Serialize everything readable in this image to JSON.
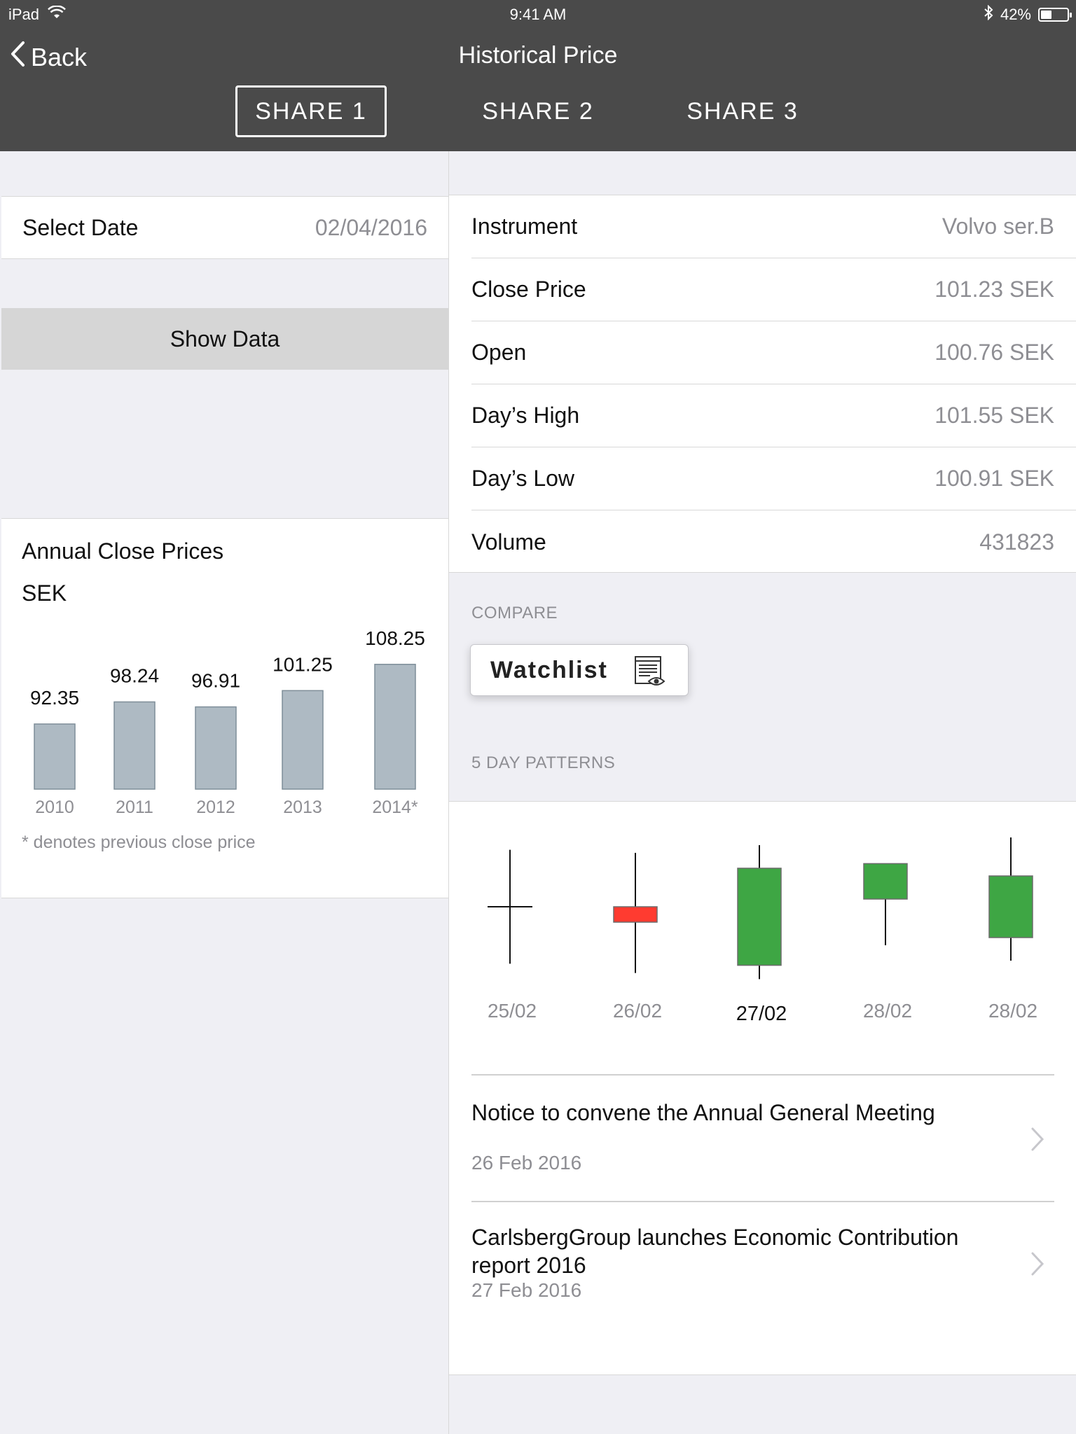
{
  "status_bar": {
    "device": "iPad",
    "time": "9:41 AM",
    "battery": "42%",
    "battery_level": 0.42
  },
  "nav": {
    "back_label": "Back",
    "title": "Historical Price"
  },
  "tabs": [
    {
      "label": "SHARE 1",
      "active": true
    },
    {
      "label": "SHARE 2",
      "active": false
    },
    {
      "label": "SHARE 3",
      "active": false
    }
  ],
  "date_selector": {
    "label": "Select Date",
    "value": "02/04/2016"
  },
  "show_data_label": "Show Data",
  "instrument_info": [
    {
      "label": "Instrument",
      "value": "Volvo ser.B"
    },
    {
      "label": "Close Price",
      "value": "101.23 SEK"
    },
    {
      "label": "Open",
      "value": "100.76 SEK"
    },
    {
      "label": "Day’s High",
      "value": "101.55 SEK"
    },
    {
      "label": "Day’s Low",
      "value": "100.91 SEK"
    },
    {
      "label": "Volume",
      "value": "431823"
    }
  ],
  "compare": {
    "label": "COMPARE",
    "watchlist_label": "Watchlist"
  },
  "patterns_label": "5 DAY PATTERNS",
  "chart_data": [
    {
      "type": "bar",
      "title": "Annual Close Prices",
      "ylabel": "SEK",
      "categories": [
        "2010",
        "2011",
        "2012",
        "2013",
        "2014*"
      ],
      "values": [
        92.35,
        98.24,
        96.91,
        101.25,
        108.25
      ],
      "value_labels": [
        "92.35",
        "98.24",
        "96.91",
        "101.25",
        "108.25"
      ],
      "note": "* denotes previous close price",
      "bar_color": "#aebac3"
    },
    {
      "type": "candlestick",
      "categories": [
        "25/02",
        "26/02",
        "27/02",
        "28/02",
        "28/02"
      ],
      "highlighted_index": 2,
      "candles": [
        {
          "open": 0.5,
          "close": 0.5,
          "high": 0.13,
          "low": 0.87,
          "color": "none"
        },
        {
          "open": 0.5,
          "close": 0.6,
          "high": 0.15,
          "low": 0.93,
          "color": "#ff3b30"
        },
        {
          "open": 0.25,
          "close": 0.88,
          "high": 0.1,
          "low": 0.97,
          "color": "#3ea644"
        },
        {
          "open": 0.22,
          "close": 0.45,
          "high": 0.22,
          "low": 0.75,
          "color": "#3ea644"
        },
        {
          "open": 0.3,
          "close": 0.7,
          "high": 0.05,
          "low": 0.85,
          "color": "#3ea644"
        }
      ]
    }
  ],
  "news": [
    {
      "title": "Notice to convene the Annual General Meeting",
      "date": "26 Feb 2016"
    },
    {
      "title": "CarlsbergGroup launches Economic Contribution report 2016",
      "date": "27 Feb 2016"
    }
  ]
}
